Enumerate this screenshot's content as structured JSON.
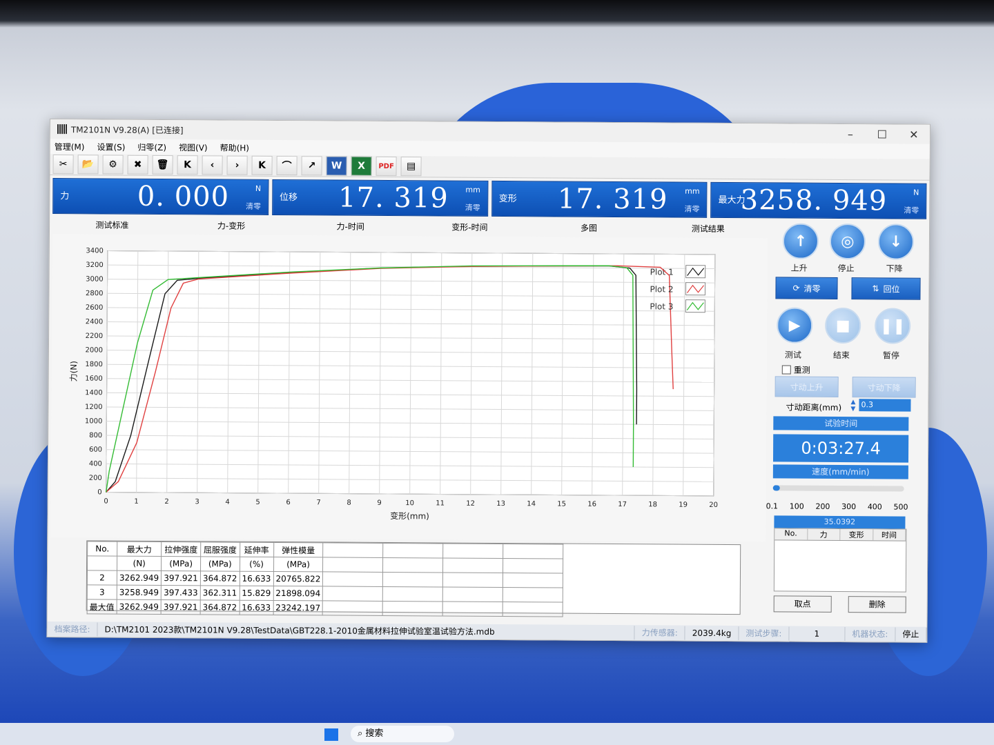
{
  "window": {
    "title": "TM2101N V9.28(A)  [已连接]",
    "minimize": "–",
    "maximize": "☐",
    "close": "✕"
  },
  "menu": [
    "管理(M)",
    "设置(S)",
    "归零(Z)",
    "视图(V)",
    "帮助(H)"
  ],
  "toolbar_icons": [
    "tools-icon",
    "open-folder-icon",
    "settings-doc-icon",
    "delete-doc-icon",
    "trash-icon",
    "first-icon",
    "prev-icon",
    "next-icon",
    "last-icon",
    "curve-icon",
    "fit-icon",
    "word-icon",
    "excel-icon",
    "pdf-icon",
    "print-preview-icon"
  ],
  "toolbar_glyphs": [
    "✂",
    "📂",
    "⚙",
    "✖",
    "🗑",
    "K",
    "‹",
    "›",
    "K",
    "⌒",
    "↗",
    "W",
    "X",
    "PDF",
    "▤"
  ],
  "meters": [
    {
      "label": "力",
      "value": "0. 000",
      "unit": "N",
      "zero": "清零"
    },
    {
      "label": "位移",
      "value": "17. 319",
      "unit": "mm",
      "zero": "清零"
    },
    {
      "label": "变形",
      "value": "17. 319",
      "unit": "mm",
      "zero": "清零"
    },
    {
      "label": "最大力",
      "value": "3258. 949",
      "unit": "N",
      "zero": "清零"
    }
  ],
  "tabs": [
    "测试标准",
    "力-变形",
    "力-时间",
    "变形-时间",
    "多图",
    "测试结果"
  ],
  "chart_data": {
    "type": "line",
    "xlabel": "变形(mm)",
    "ylabel": "力(N)",
    "xlim": [
      0,
      20
    ],
    "ylim": [
      0,
      3400
    ],
    "xticks": [
      0,
      1,
      2,
      3,
      4,
      5,
      6,
      7,
      8,
      9,
      10,
      11,
      12,
      13,
      14,
      15,
      16,
      17,
      18,
      19,
      20
    ],
    "yticks": [
      0,
      200,
      400,
      600,
      800,
      1000,
      1200,
      1400,
      1600,
      1800,
      2000,
      2200,
      2400,
      2600,
      2800,
      3000,
      3200,
      3400
    ],
    "legend": "top-right",
    "series": [
      {
        "name": "Plot 1",
        "color": "#1a1a1a",
        "x": [
          0,
          0.3,
          0.8,
          1.4,
          1.9,
          2.3,
          3,
          6,
          9,
          12,
          15,
          16.5,
          17.2,
          17.4,
          17.45,
          17.45
        ],
        "y": [
          0,
          150,
          800,
          1900,
          2800,
          2990,
          3020,
          3110,
          3180,
          3215,
          3225,
          3230,
          3200,
          3100,
          1500,
          1000
        ]
      },
      {
        "name": "Plot 2",
        "color": "#e04040",
        "x": [
          0,
          0.4,
          1,
          1.6,
          2.1,
          2.5,
          3,
          6,
          9,
          12,
          15,
          16.8,
          18.2,
          18.5,
          18.6,
          18.65
        ],
        "y": [
          0,
          150,
          700,
          1700,
          2600,
          2950,
          3010,
          3100,
          3175,
          3210,
          3225,
          3232,
          3215,
          3100,
          2000,
          1500
        ]
      },
      {
        "name": "Plot 3",
        "color": "#33bb33",
        "x": [
          0,
          0.1,
          0.5,
          1,
          1.5,
          2,
          3,
          6,
          9,
          12,
          15,
          16.5,
          17.1,
          17.3,
          17.35,
          17.35
        ],
        "y": [
          0,
          300,
          1100,
          2100,
          2850,
          3000,
          3030,
          3115,
          3182,
          3218,
          3228,
          3232,
          3205,
          3100,
          1000,
          400
        ]
      }
    ]
  },
  "results": {
    "headers": [
      [
        "No.",
        ""
      ],
      [
        "最大力",
        "(N)"
      ],
      [
        "拉伸强度",
        "(MPa)"
      ],
      [
        "屈服强度",
        "(MPa)"
      ],
      [
        "延伸率",
        "(%)"
      ],
      [
        "弹性模量",
        "(MPa)"
      ]
    ],
    "rows": [
      [
        "2",
        "3262.949",
        "397.921",
        "364.872",
        "16.633",
        "20765.822"
      ],
      [
        "3",
        "3258.949",
        "397.433",
        "362.311",
        "15.829",
        "21898.094"
      ],
      [
        "最大值",
        "3262.949",
        "397.921",
        "364.872",
        "16.633",
        "23242.197"
      ]
    ]
  },
  "side": {
    "up": "上升",
    "stop": "停止",
    "down": "下降",
    "zero": "清零",
    "return": "回位",
    "test": "测试",
    "end": "结束",
    "pause": "暂停",
    "retest": "重测",
    "jog_up": "寸动上升",
    "jog_down": "寸动下降",
    "jog_distance_label": "寸动距离(mm)",
    "jog_distance": "0.3",
    "test_time_label": "试验时间",
    "test_time": "0:03:27.4",
    "speed_label": "速度(mm/min)",
    "speed_ticks": [
      "0.1",
      "100",
      "200",
      "300",
      "400",
      "500"
    ],
    "speed_value": 0.02,
    "point_value": "35.0392",
    "point_headers": [
      "No.",
      "力",
      "变形",
      "时间"
    ],
    "take_point": "取点",
    "delete": "删除"
  },
  "status": {
    "path_label": "档案路径:",
    "path": "D:\\TM2101 2023款\\TM2101N V9.28\\TestData\\GBT228.1-2010金属材料拉伸试验室温试验方法.mdb",
    "sensor_label": "力传感器:",
    "sensor": "2039.4kg",
    "step_label": "测试步骤:",
    "step": "1",
    "machine_label": "机器状态:",
    "machine": "停止"
  },
  "taskbar": {
    "search": "搜索"
  }
}
